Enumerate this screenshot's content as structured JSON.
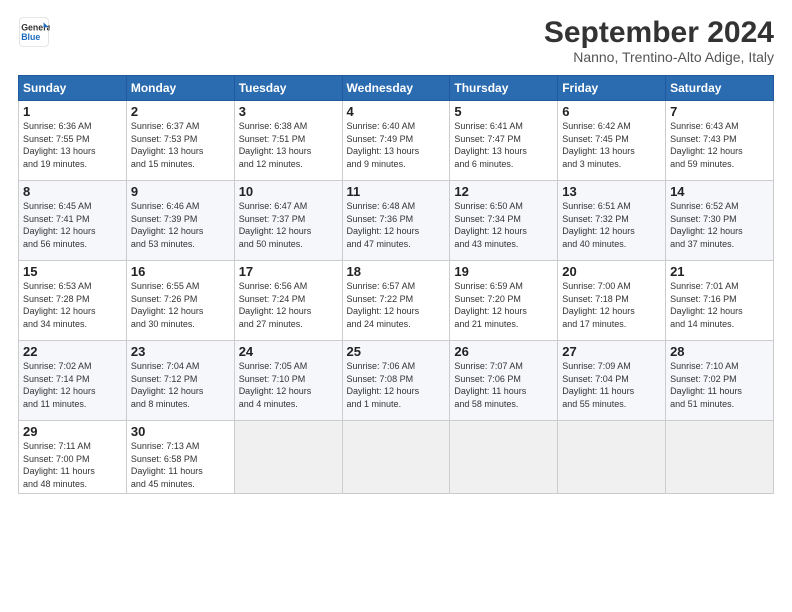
{
  "header": {
    "logo_line1": "General",
    "logo_line2": "Blue",
    "month": "September 2024",
    "location": "Nanno, Trentino-Alto Adige, Italy"
  },
  "columns": [
    "Sunday",
    "Monday",
    "Tuesday",
    "Wednesday",
    "Thursday",
    "Friday",
    "Saturday"
  ],
  "weeks": [
    [
      {
        "day": "1",
        "lines": [
          "Sunrise: 6:36 AM",
          "Sunset: 7:55 PM",
          "Daylight: 13 hours",
          "and 19 minutes."
        ]
      },
      {
        "day": "2",
        "lines": [
          "Sunrise: 6:37 AM",
          "Sunset: 7:53 PM",
          "Daylight: 13 hours",
          "and 15 minutes."
        ]
      },
      {
        "day": "3",
        "lines": [
          "Sunrise: 6:38 AM",
          "Sunset: 7:51 PM",
          "Daylight: 13 hours",
          "and 12 minutes."
        ]
      },
      {
        "day": "4",
        "lines": [
          "Sunrise: 6:40 AM",
          "Sunset: 7:49 PM",
          "Daylight: 13 hours",
          "and 9 minutes."
        ]
      },
      {
        "day": "5",
        "lines": [
          "Sunrise: 6:41 AM",
          "Sunset: 7:47 PM",
          "Daylight: 13 hours",
          "and 6 minutes."
        ]
      },
      {
        "day": "6",
        "lines": [
          "Sunrise: 6:42 AM",
          "Sunset: 7:45 PM",
          "Daylight: 13 hours",
          "and 3 minutes."
        ]
      },
      {
        "day": "7",
        "lines": [
          "Sunrise: 6:43 AM",
          "Sunset: 7:43 PM",
          "Daylight: 12 hours",
          "and 59 minutes."
        ]
      }
    ],
    [
      {
        "day": "8",
        "lines": [
          "Sunrise: 6:45 AM",
          "Sunset: 7:41 PM",
          "Daylight: 12 hours",
          "and 56 minutes."
        ]
      },
      {
        "day": "9",
        "lines": [
          "Sunrise: 6:46 AM",
          "Sunset: 7:39 PM",
          "Daylight: 12 hours",
          "and 53 minutes."
        ]
      },
      {
        "day": "10",
        "lines": [
          "Sunrise: 6:47 AM",
          "Sunset: 7:37 PM",
          "Daylight: 12 hours",
          "and 50 minutes."
        ]
      },
      {
        "day": "11",
        "lines": [
          "Sunrise: 6:48 AM",
          "Sunset: 7:36 PM",
          "Daylight: 12 hours",
          "and 47 minutes."
        ]
      },
      {
        "day": "12",
        "lines": [
          "Sunrise: 6:50 AM",
          "Sunset: 7:34 PM",
          "Daylight: 12 hours",
          "and 43 minutes."
        ]
      },
      {
        "day": "13",
        "lines": [
          "Sunrise: 6:51 AM",
          "Sunset: 7:32 PM",
          "Daylight: 12 hours",
          "and 40 minutes."
        ]
      },
      {
        "day": "14",
        "lines": [
          "Sunrise: 6:52 AM",
          "Sunset: 7:30 PM",
          "Daylight: 12 hours",
          "and 37 minutes."
        ]
      }
    ],
    [
      {
        "day": "15",
        "lines": [
          "Sunrise: 6:53 AM",
          "Sunset: 7:28 PM",
          "Daylight: 12 hours",
          "and 34 minutes."
        ]
      },
      {
        "day": "16",
        "lines": [
          "Sunrise: 6:55 AM",
          "Sunset: 7:26 PM",
          "Daylight: 12 hours",
          "and 30 minutes."
        ]
      },
      {
        "day": "17",
        "lines": [
          "Sunrise: 6:56 AM",
          "Sunset: 7:24 PM",
          "Daylight: 12 hours",
          "and 27 minutes."
        ]
      },
      {
        "day": "18",
        "lines": [
          "Sunrise: 6:57 AM",
          "Sunset: 7:22 PM",
          "Daylight: 12 hours",
          "and 24 minutes."
        ]
      },
      {
        "day": "19",
        "lines": [
          "Sunrise: 6:59 AM",
          "Sunset: 7:20 PM",
          "Daylight: 12 hours",
          "and 21 minutes."
        ]
      },
      {
        "day": "20",
        "lines": [
          "Sunrise: 7:00 AM",
          "Sunset: 7:18 PM",
          "Daylight: 12 hours",
          "and 17 minutes."
        ]
      },
      {
        "day": "21",
        "lines": [
          "Sunrise: 7:01 AM",
          "Sunset: 7:16 PM",
          "Daylight: 12 hours",
          "and 14 minutes."
        ]
      }
    ],
    [
      {
        "day": "22",
        "lines": [
          "Sunrise: 7:02 AM",
          "Sunset: 7:14 PM",
          "Daylight: 12 hours",
          "and 11 minutes."
        ]
      },
      {
        "day": "23",
        "lines": [
          "Sunrise: 7:04 AM",
          "Sunset: 7:12 PM",
          "Daylight: 12 hours",
          "and 8 minutes."
        ]
      },
      {
        "day": "24",
        "lines": [
          "Sunrise: 7:05 AM",
          "Sunset: 7:10 PM",
          "Daylight: 12 hours",
          "and 4 minutes."
        ]
      },
      {
        "day": "25",
        "lines": [
          "Sunrise: 7:06 AM",
          "Sunset: 7:08 PM",
          "Daylight: 12 hours",
          "and 1 minute."
        ]
      },
      {
        "day": "26",
        "lines": [
          "Sunrise: 7:07 AM",
          "Sunset: 7:06 PM",
          "Daylight: 11 hours",
          "and 58 minutes."
        ]
      },
      {
        "day": "27",
        "lines": [
          "Sunrise: 7:09 AM",
          "Sunset: 7:04 PM",
          "Daylight: 11 hours",
          "and 55 minutes."
        ]
      },
      {
        "day": "28",
        "lines": [
          "Sunrise: 7:10 AM",
          "Sunset: 7:02 PM",
          "Daylight: 11 hours",
          "and 51 minutes."
        ]
      }
    ],
    [
      {
        "day": "29",
        "lines": [
          "Sunrise: 7:11 AM",
          "Sunset: 7:00 PM",
          "Daylight: 11 hours",
          "and 48 minutes."
        ]
      },
      {
        "day": "30",
        "lines": [
          "Sunrise: 7:13 AM",
          "Sunset: 6:58 PM",
          "Daylight: 11 hours",
          "and 45 minutes."
        ]
      },
      null,
      null,
      null,
      null,
      null
    ]
  ]
}
